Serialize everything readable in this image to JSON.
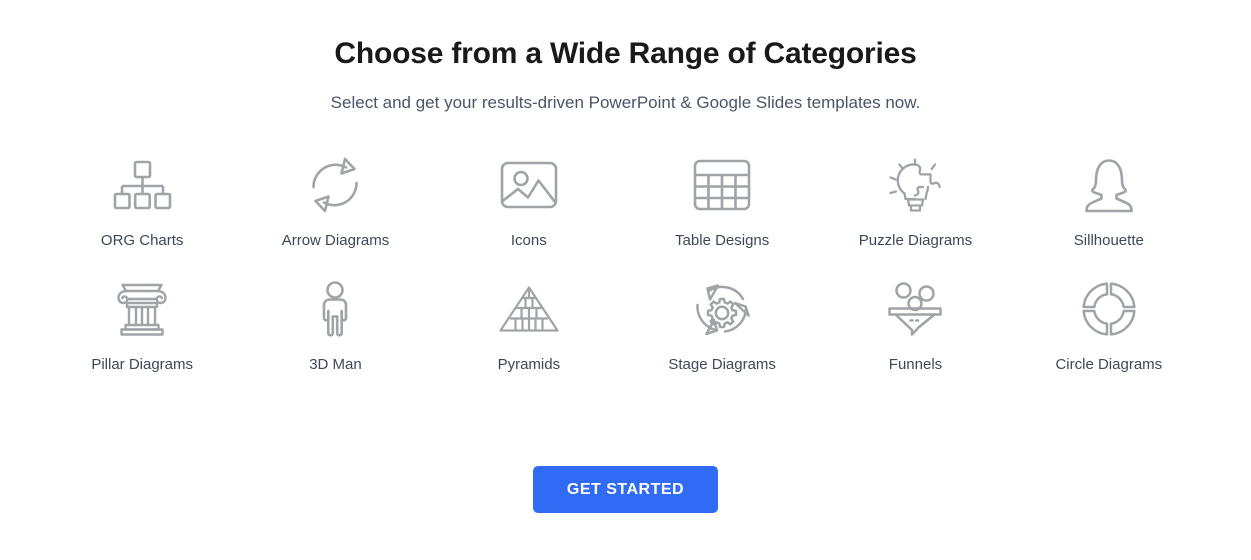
{
  "header": {
    "title": "Choose from a Wide Range of Categories",
    "subtitle": "Select and get your results-driven PowerPoint & Google Slides templates now."
  },
  "colors": {
    "title": "#1a1a1a",
    "subtitle": "#4a5568",
    "label": "#3c4858",
    "icon_stroke": "#a0a4a8",
    "cta_background": "#2f6bf5",
    "cta_text": "#ffffff",
    "page_background": "#ffffff"
  },
  "categories": [
    {
      "label": "ORG Charts",
      "icon": "org-chart-icon"
    },
    {
      "label": "Arrow Diagrams",
      "icon": "circular-arrows-icon"
    },
    {
      "label": "Icons",
      "icon": "image-placeholder-icon"
    },
    {
      "label": "Table Designs",
      "icon": "table-grid-icon"
    },
    {
      "label": "Puzzle Diagrams",
      "icon": "puzzle-lightbulb-icon"
    },
    {
      "label": "Sillhouette",
      "icon": "person-bust-icon"
    },
    {
      "label": "Pillar Diagrams",
      "icon": "column-pillar-icon"
    },
    {
      "label": "3D Man",
      "icon": "standing-person-icon"
    },
    {
      "label": "Pyramids",
      "icon": "pyramid-icon"
    },
    {
      "label": "Stage Diagrams",
      "icon": "gear-cycle-icon"
    },
    {
      "label": "Funnels",
      "icon": "funnel-icon"
    },
    {
      "label": "Circle Diagrams",
      "icon": "donut-quadrants-icon"
    }
  ],
  "cta": {
    "label": "GET STARTED"
  }
}
